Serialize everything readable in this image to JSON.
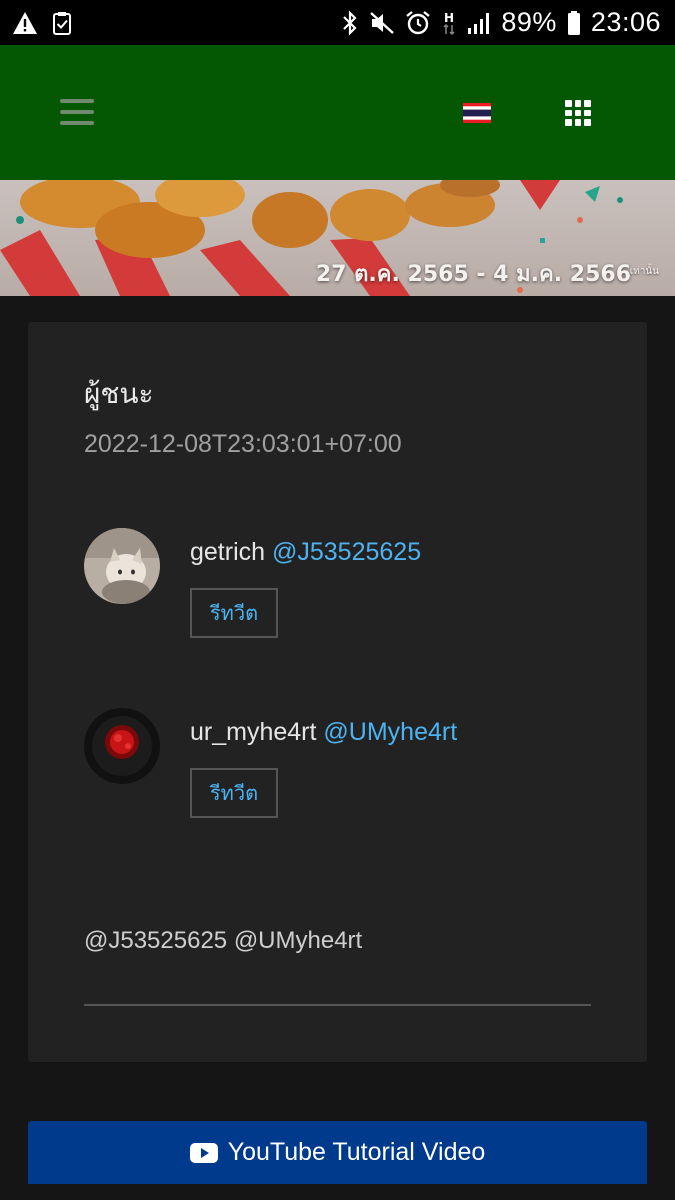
{
  "status_bar": {
    "battery": "89%",
    "time": "23:06",
    "left_icons": [
      "warning-icon",
      "clipboard-check-icon"
    ],
    "right_icons": [
      "bluetooth-icon",
      "mute-icon",
      "alarm-icon",
      "network-h-icon",
      "signal-icon",
      "battery-icon"
    ]
  },
  "header": {
    "bg_color": "#045804",
    "menu_icon": "hamburger-icon",
    "language_icon": "thai-flag-icon",
    "apps_icon": "grid-icon"
  },
  "banner": {
    "date_range": "27 ต.ค. 2565 - 4 ม.ค. 2566",
    "suffix": "เท่านั้น"
  },
  "card": {
    "title": "ผู้ชนะ",
    "datetime": "2022-12-08T23:03:01+07:00",
    "winners": [
      {
        "name": "getrich",
        "handle": "@J53525625",
        "button": "รีทวีต"
      },
      {
        "name": "ur_myhe4rt",
        "handle": "@UMyhe4rt",
        "button": "รีทวีต"
      }
    ],
    "mentions": "@J53525625 @UMyhe4rt"
  },
  "youtube_button": {
    "label": "YouTube Tutorial Video",
    "icon": "youtube-icon",
    "color": "#003a8c"
  },
  "accent_color": "#4db3f0"
}
